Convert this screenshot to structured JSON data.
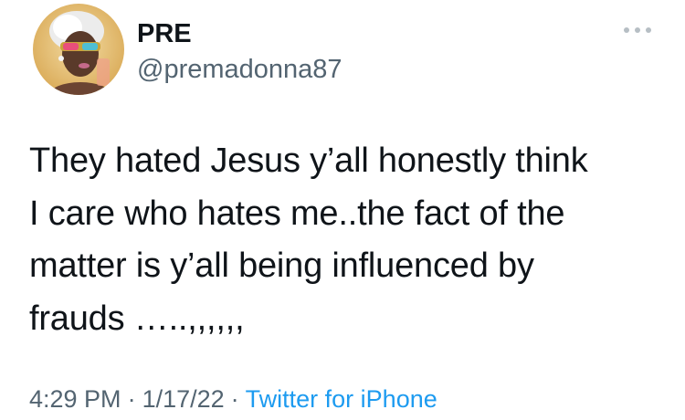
{
  "tweet": {
    "author": {
      "display_name": "PRE",
      "handle": "@premadonna87",
      "avatar_icon": "profile-avatar"
    },
    "more_icon": "ellipsis-icon",
    "text_lines": [
      "They hated Jesus y’all honestly think",
      "I care who hates me..the fact of the",
      "matter is y’all being influenced by",
      "frauds …..,,,,,,"
    ],
    "meta": {
      "time": "4:29 PM",
      "separator": "·",
      "date": "1/17/22",
      "source": "Twitter for iPhone"
    }
  },
  "colors": {
    "primary_text": "#0f1419",
    "secondary_text": "#536471",
    "link": "#1d9bf0",
    "background": "#ffffff"
  }
}
